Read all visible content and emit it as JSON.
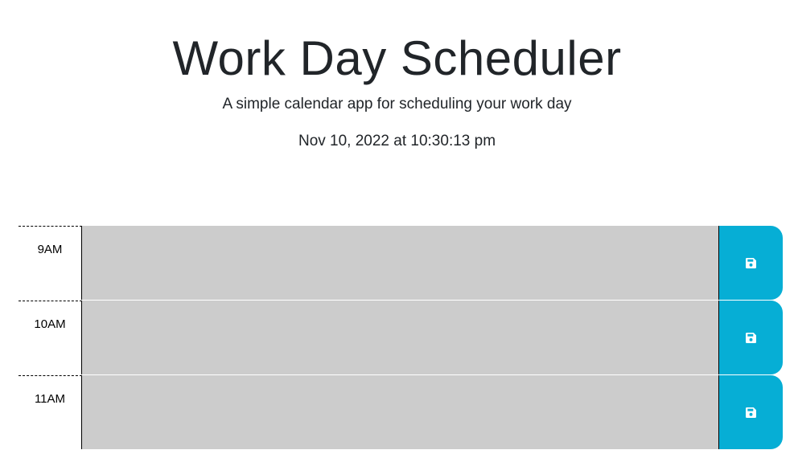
{
  "header": {
    "title": "Work Day Scheduler",
    "subtitle": "A simple calendar app for scheduling your work day",
    "current_day": "Nov 10, 2022 at 10:30:13 pm"
  },
  "time_blocks": [
    {
      "hour": "9AM",
      "description": "",
      "status": "past"
    },
    {
      "hour": "10AM",
      "description": "",
      "status": "past"
    },
    {
      "hour": "11AM",
      "description": "",
      "status": "past"
    }
  ],
  "colors": {
    "past": "#cccccc",
    "save_button": "#06aed5",
    "save_icon": "#ffffff"
  },
  "icons": {
    "save": "floppy-disk-icon"
  }
}
